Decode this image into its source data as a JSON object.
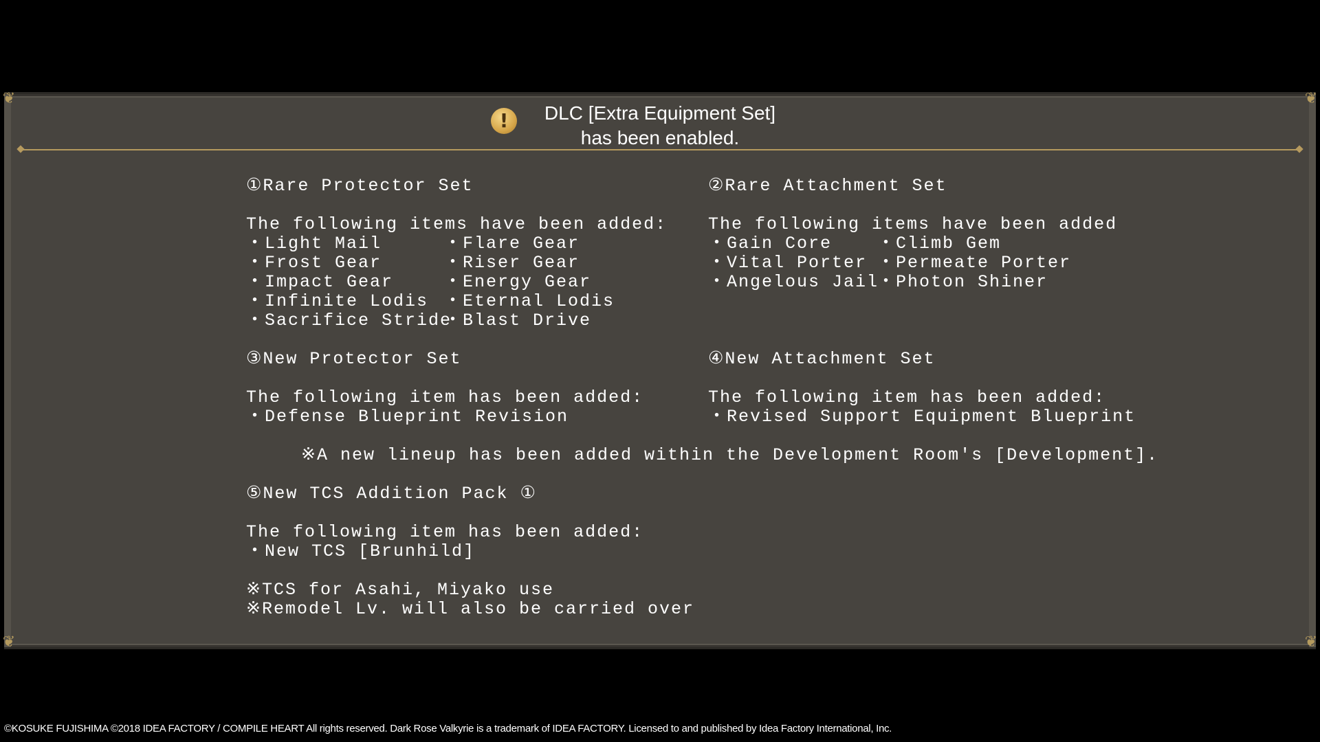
{
  "dialog": {
    "title_line1": "DLC [Extra Equipment Set]",
    "title_line2": "has been enabled.",
    "alert_glyph": "!"
  },
  "sections": {
    "s1": {
      "heading": "①Rare Protector Set",
      "intro": "The following items have been added:",
      "items_col1": [
        "・Light Mail",
        "・Frost Gear",
        "・Impact Gear",
        "・Infinite Lodis",
        "・Sacrifice Stride"
      ],
      "items_col2": [
        "・Flare Gear",
        "・Riser Gear",
        "・Energy Gear",
        "・Eternal Lodis",
        "・Blast Drive"
      ]
    },
    "s2": {
      "heading": "②Rare Attachment Set",
      "intro": "The following items have been added",
      "items_col1": [
        "・Gain Core",
        "・Vital Porter",
        "・Angelous Jail"
      ],
      "items_col2": [
        "・Climb Gem",
        "・Permeate Porter",
        "・Photon Shiner"
      ]
    },
    "s3": {
      "heading": "③New Protector Set",
      "intro": "The following item has been added:",
      "items": [
        "・Defense Blueprint Revision"
      ]
    },
    "s4": {
      "heading": "④New Attachment Set",
      "intro": "The following item has been added:",
      "items": [
        "・Revised Support Equipment Blueprint"
      ]
    },
    "lineup_note": "※A new lineup has been added within the Development Room's [Development].",
    "s5": {
      "heading": "⑤New TCS Addition Pack ①",
      "intro": "The following item has been added:",
      "items": [
        "・New TCS [Brunhild]"
      ],
      "notes": [
        "※TCS for Asahi, Miyako use",
        "※Remodel Lv. will also be carried over"
      ]
    }
  },
  "footer": {
    "copyright": "©KOSUKE FUJISHIMA ©2018 IDEA FACTORY / COMPILE HEART All rights reserved. Dark Rose Valkyrie is a trademark of IDEA FACTORY. Licensed to and published by Idea Factory International, Inc."
  },
  "colors": {
    "panel": "#47443f",
    "gold": "#b69a5e",
    "text": "#ffffff"
  }
}
